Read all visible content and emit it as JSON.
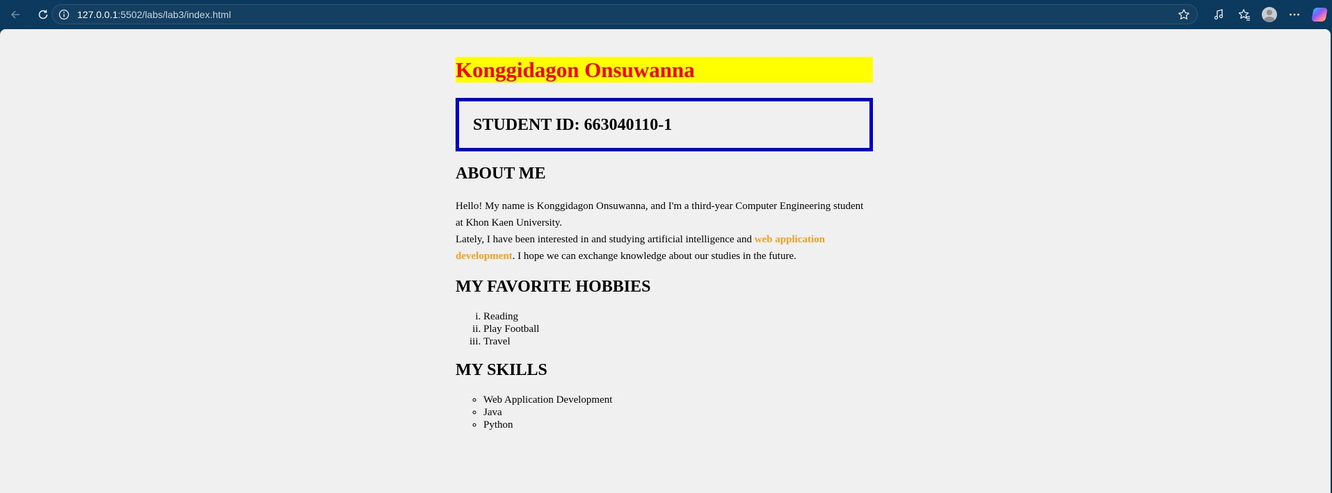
{
  "browser": {
    "url_host": "127.0.0.1",
    "url_rest": ":5502/labs/lab3/index.html"
  },
  "page": {
    "name_heading": "Konggidagon Onsuwanna",
    "student_id": "STUDENT ID: 663040110-1",
    "about": {
      "title": "ABOUT ME",
      "line1": "Hello! My name is Konggidagon Onsuwanna, and I'm a third-year Computer Engineering student at Khon Kaen University.",
      "line2_before": "Lately, I have been interested in and studying artificial intelligence and ",
      "line2_highlight": "web application development",
      "line2_after": ". I hope we can exchange knowledge about our studies in the future."
    },
    "hobbies": {
      "title": "MY FAVORITE HOBBIES",
      "items": [
        "Reading",
        "Play Football",
        "Travel"
      ]
    },
    "skills": {
      "title": "MY SKILLS",
      "items": [
        "Web Application Development",
        "Java",
        "Python"
      ]
    }
  },
  "colors": {
    "name_bg": "#ffff00",
    "name_text": "#ff0000",
    "id_border": "#0000cc",
    "highlight": "#f7a020",
    "chrome": "#0b3a5e"
  },
  "icons": [
    "back-arrow-icon",
    "refresh-icon",
    "site-info-icon",
    "bookmark-star-icon",
    "read-aloud-icon",
    "favorites-icon",
    "profile-avatar",
    "more-options-icon",
    "copilot-icon"
  ]
}
